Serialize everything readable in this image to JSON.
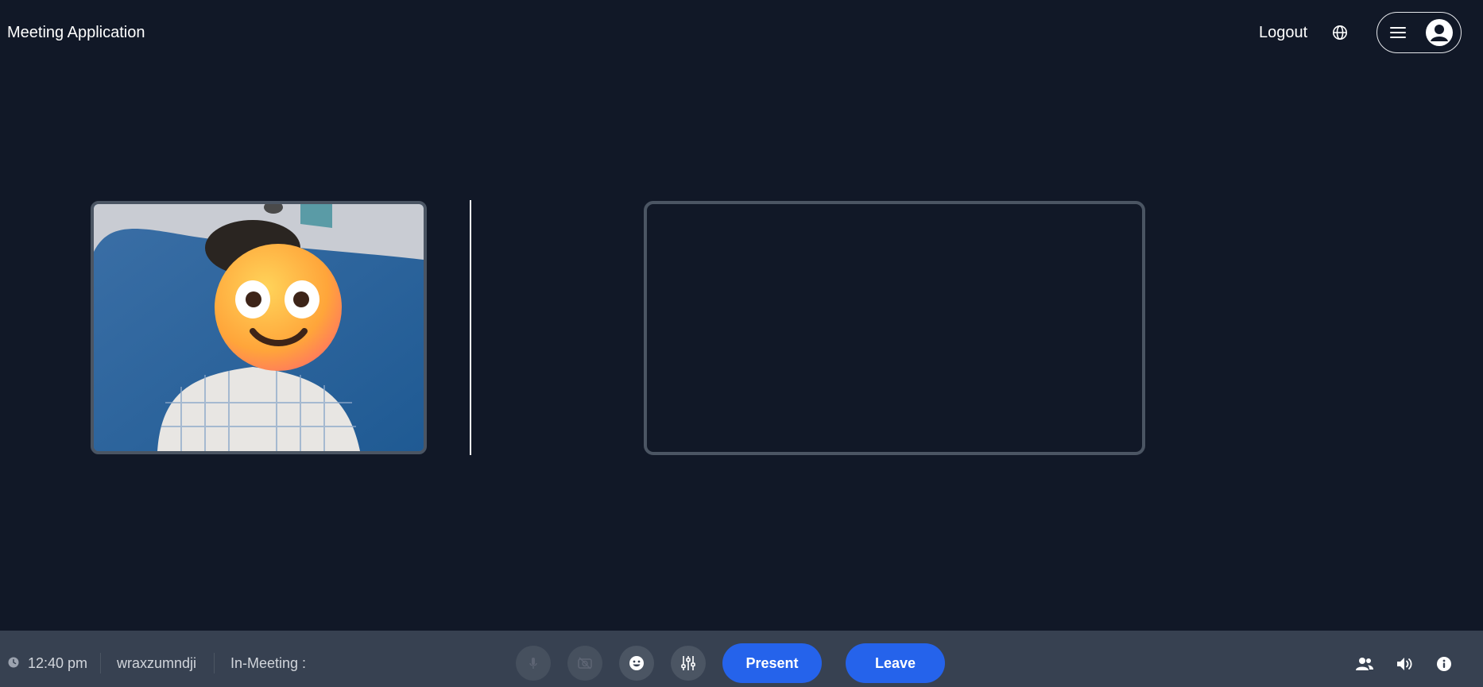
{
  "header": {
    "app_title": "Meeting Application",
    "logout_label": "Logout",
    "language_icon": "globe-icon",
    "menu_icon": "hamburger-icon",
    "avatar_icon": "user-avatar-icon"
  },
  "stage": {
    "self_video": "local-camera-feed",
    "face_overlay": "smiling-face-emoji"
  },
  "bottom_bar": {
    "time": "12:40 pm",
    "meeting_code": "wraxzumndji",
    "status_label": "In-Meeting :",
    "controls": {
      "mic_icon": "microphone-icon",
      "camera_icon": "camera-off-icon",
      "reaction_icon": "emoji-icon",
      "settings_icon": "sliders-icon",
      "present_label": "Present",
      "leave_label": "Leave"
    },
    "right_icons": [
      "participants-icon",
      "speaker-icon",
      "info-icon"
    ]
  },
  "colors": {
    "background": "#111827",
    "bar": "#374151",
    "accent": "#2563eb",
    "border": "#4b5563"
  }
}
